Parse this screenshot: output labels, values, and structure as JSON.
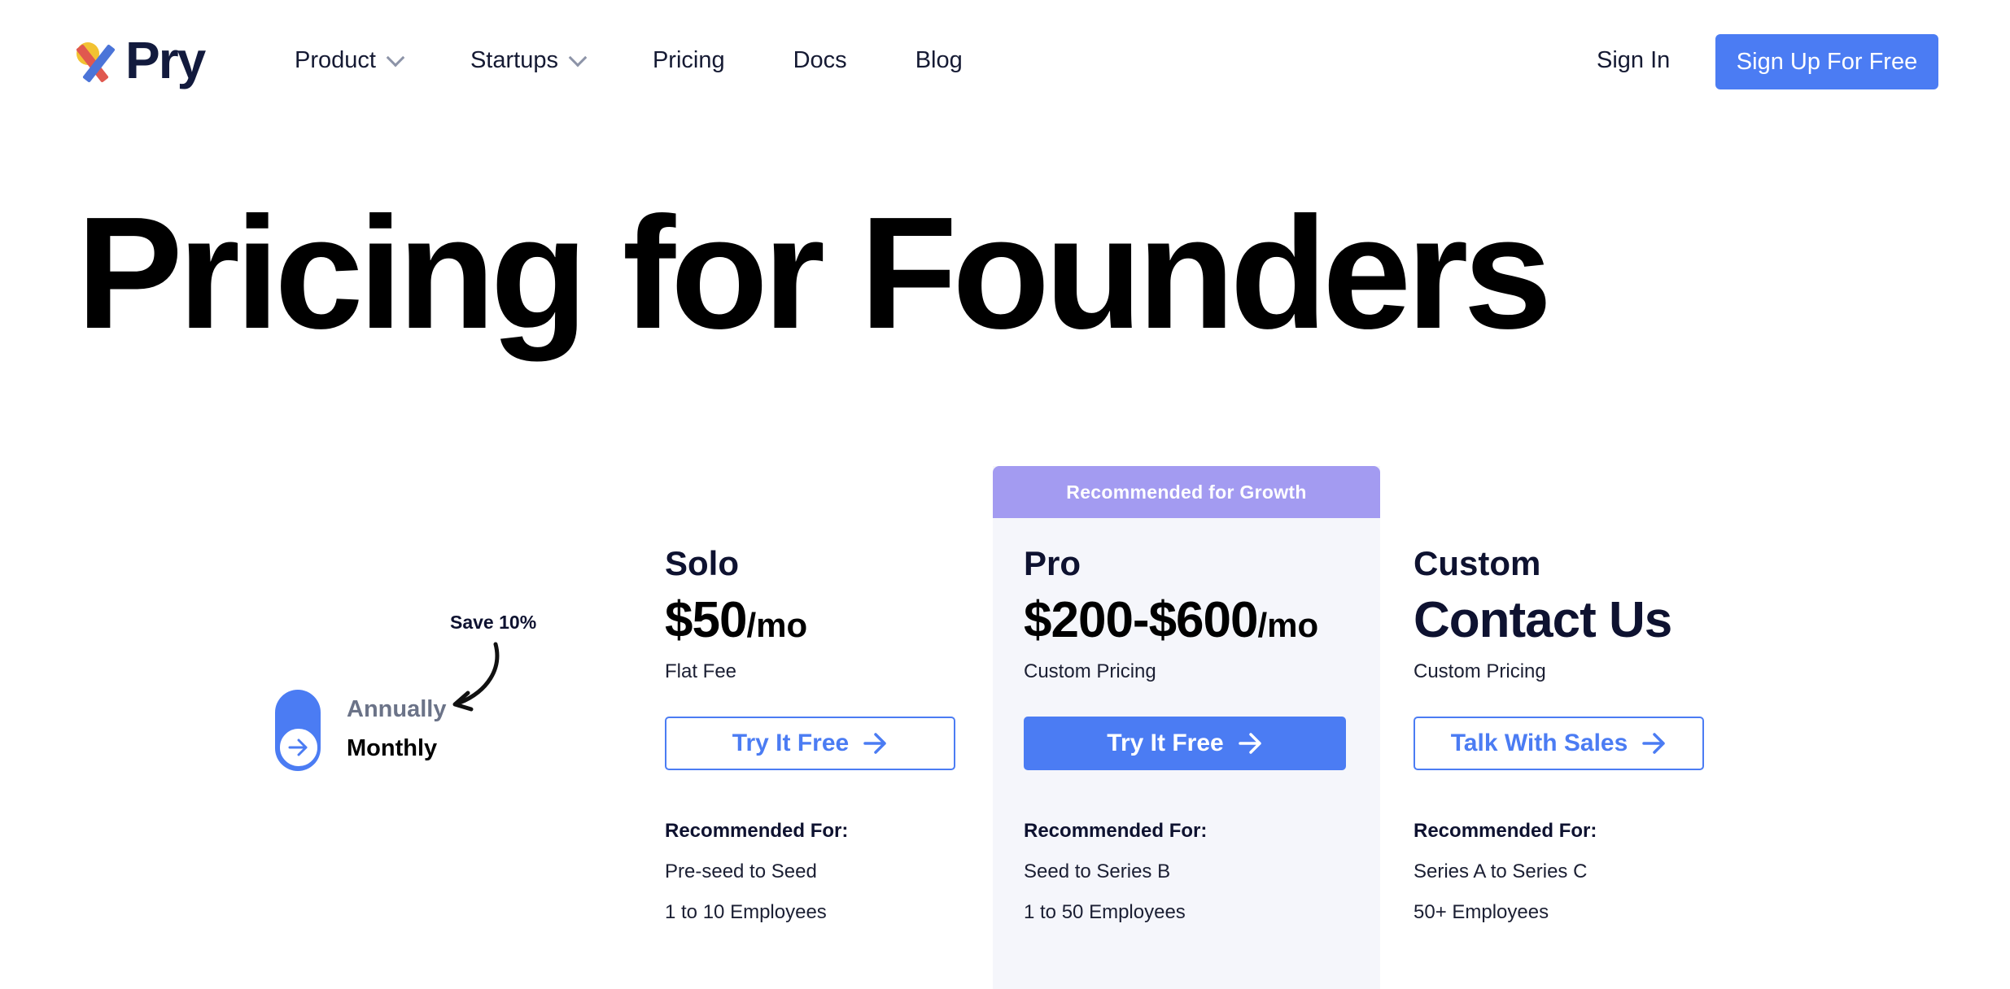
{
  "brand": {
    "name": "Pry",
    "colors": {
      "accent": "#4b7cf3",
      "banner": "#a39bf1",
      "logo_yellow": "#f2c232",
      "logo_red": "#e0584f",
      "logo_blue": "#4b74d8"
    }
  },
  "nav": {
    "items": [
      {
        "label": "Product",
        "has_dropdown": true
      },
      {
        "label": "Startups",
        "has_dropdown": true
      },
      {
        "label": "Pricing",
        "has_dropdown": false
      },
      {
        "label": "Docs",
        "has_dropdown": false
      },
      {
        "label": "Blog",
        "has_dropdown": false
      }
    ],
    "sign_in": "Sign In",
    "sign_up": "Sign Up For Free"
  },
  "hero": {
    "title": "Pricing for Founders"
  },
  "billing": {
    "save_note": "Save 10%",
    "annually_label": "Annually",
    "monthly_label": "Monthly",
    "selected": "Monthly"
  },
  "plans": [
    {
      "name": "Solo",
      "price": "$50",
      "unit": "/mo",
      "subtitle": "Flat Fee",
      "cta": "Try It Free",
      "cta_icon": "arrow-right-icon",
      "rec_heading": "Recommended For:",
      "rec_items": [
        "Pre-seed to Seed",
        "1 to 10 Employees"
      ]
    },
    {
      "name": "Pro",
      "price": "$200-$600",
      "unit": "/mo",
      "subtitle": "Custom Pricing",
      "banner": "Recommended for Growth",
      "cta": "Try It Free",
      "cta_icon": "arrow-right-icon",
      "rec_heading": "Recommended For:",
      "rec_items": [
        "Seed to Series B",
        "1 to 50 Employees"
      ]
    },
    {
      "name": "Custom",
      "price": "Contact Us",
      "unit": "",
      "subtitle": "Custom Pricing",
      "cta": "Talk With Sales",
      "cta_icon": "arrow-right-icon",
      "rec_heading": "Recommended For:",
      "rec_items": [
        "Series A to Series C",
        "50+ Employees"
      ]
    }
  ]
}
